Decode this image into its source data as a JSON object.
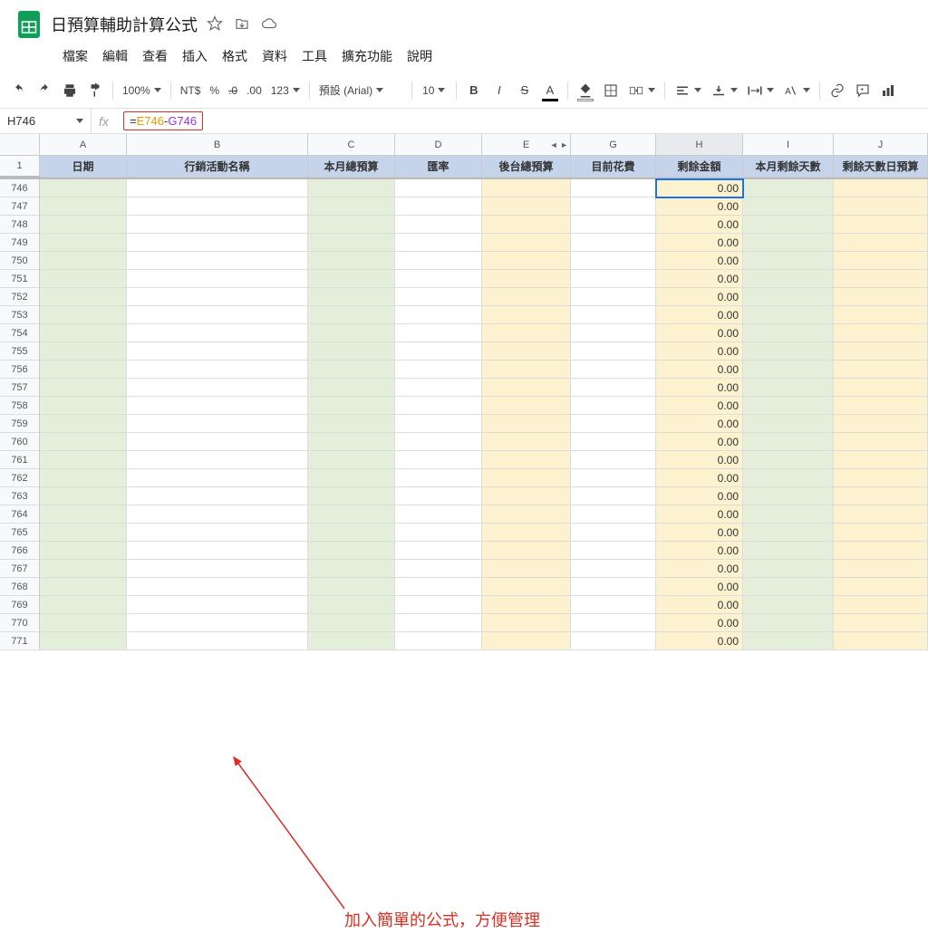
{
  "doc_title": "日預算輔助計算公式",
  "menu": [
    "檔案",
    "編輯",
    "查看",
    "插入",
    "格式",
    "資料",
    "工具",
    "擴充功能",
    "說明"
  ],
  "toolbar": {
    "zoom": "100%",
    "currency": "NT$",
    "percent": "%",
    "dec_dec": ".0",
    "dec_inc": ".00",
    "numfmt": "123",
    "font": "預設 (Arial)",
    "size": "10"
  },
  "name_box": "H746",
  "fx_label": "fx",
  "formula": {
    "eq": "=",
    "ref1": "E746",
    "op": "-",
    "ref2": "G746"
  },
  "column_labels": [
    "A",
    "B",
    "C",
    "D",
    "E",
    "G",
    "H",
    "I",
    "J"
  ],
  "frozen_row_num": "1",
  "headers": [
    "日期",
    "行銷活動名稱",
    "本月總預算",
    "匯率",
    "後台總預算",
    "目前花費",
    "剩餘金額",
    "本月剩餘天數",
    "剩餘天數日預算"
  ],
  "row_start": 746,
  "row_count": 26,
  "h_value": "0.00",
  "hidden_col_nav": "◄ ►",
  "annotation_text": "加入簡單的公式，方便管理"
}
